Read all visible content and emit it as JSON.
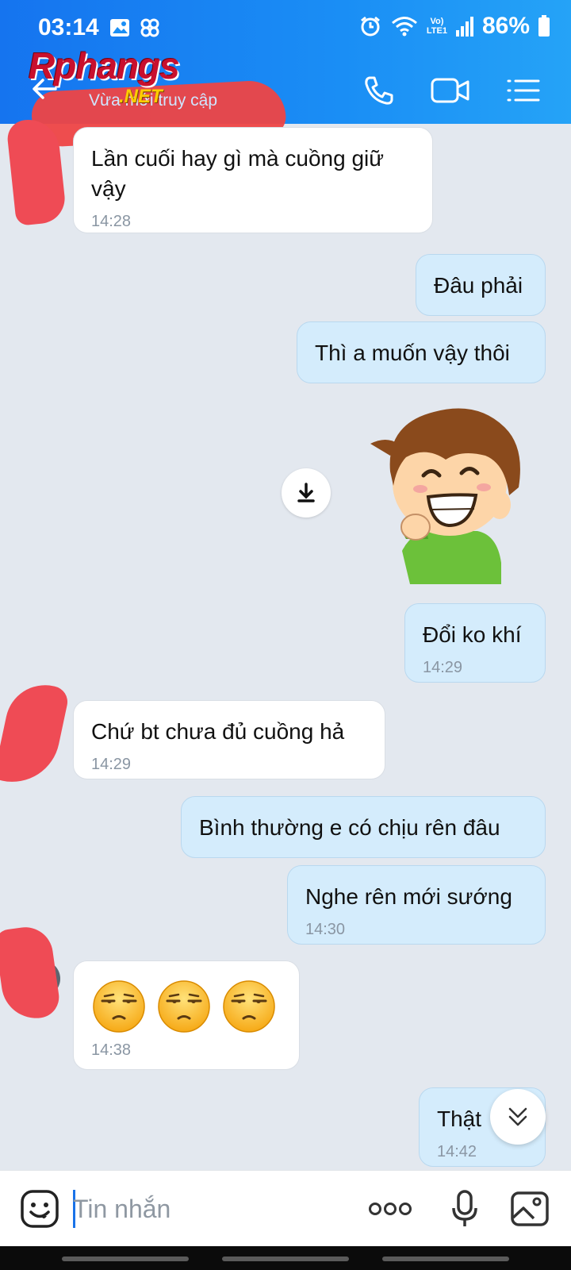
{
  "status_bar": {
    "time": "03:14",
    "battery": "86%",
    "network_top": "Vo)",
    "network_bottom": "LTE1"
  },
  "header": {
    "subtitle": "Vừa mới truy cập",
    "watermark_main": "Rphangs",
    "watermark_sub": ".NET"
  },
  "messages": [
    {
      "dir": "in",
      "text": "Lần cuối hay gì mà cuồng giữ vậy",
      "time": "14:28"
    },
    {
      "dir": "out",
      "text": "Đâu phải",
      "time": ""
    },
    {
      "dir": "out",
      "text": "Thì a muốn vậy thôi",
      "time": ""
    },
    {
      "dir": "out",
      "type": "sticker",
      "description": "sticker"
    },
    {
      "dir": "out",
      "text": "Đổi ko khí",
      "time": "14:29"
    },
    {
      "dir": "in",
      "text": "Chứ bt chưa đủ cuồng hả",
      "time": "14:29"
    },
    {
      "dir": "out",
      "text": "Bình thường e có chịu rên đâu",
      "time": ""
    },
    {
      "dir": "out",
      "text": "Nghe rên mới sướng",
      "time": "14:30"
    },
    {
      "dir": "in",
      "type": "emoji",
      "emoji_count": 3,
      "emoji_name": "unamused-face",
      "time": "14:38"
    },
    {
      "dir": "out",
      "text": "Thật",
      "time": "14:42"
    }
  ],
  "input": {
    "placeholder": "Tin nhắn"
  },
  "icons": {
    "back": "back-arrow-icon",
    "call": "phone-icon",
    "video": "video-camera-icon",
    "menu": "menu-list-icon",
    "download": "download-icon",
    "scroll": "chevron-double-down-icon",
    "emoji": "emoji-face-icon",
    "more": "more-dots-icon",
    "mic": "microphone-icon",
    "image": "image-icon"
  },
  "colors": {
    "header": "#1a8ef5",
    "incoming": "#ffffff",
    "outgoing": "#d4ecfc",
    "background": "#e3e8ef",
    "redaction": "#ef4b55"
  }
}
